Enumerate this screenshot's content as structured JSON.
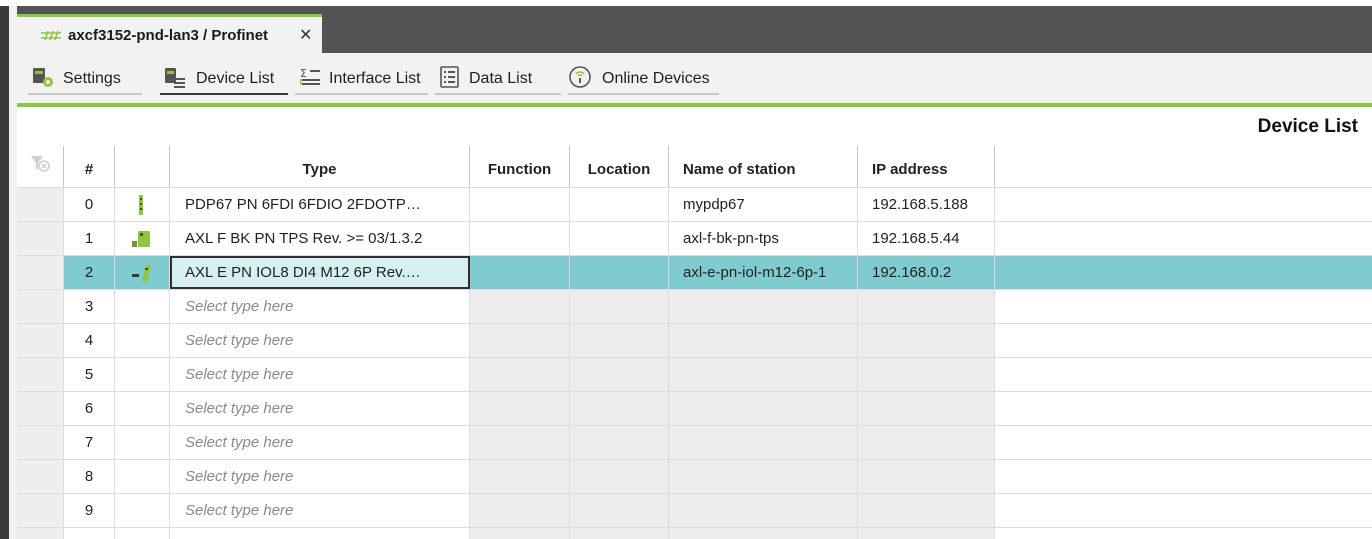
{
  "tab": {
    "title": "axcf3152-pnd-lan3 / Profinet",
    "close": "✕"
  },
  "toolbar": {
    "settings": "Settings",
    "device_list": "Device List",
    "interface_list": "Interface List",
    "data_list": "Data List",
    "online_devices": "Online Devices"
  },
  "page_title": "Device List",
  "columns": {
    "num": "#",
    "type": "Type",
    "function": "Function",
    "location": "Location",
    "station": "Name of station",
    "ip": "IP address"
  },
  "rows": [
    {
      "num": "0",
      "type": "PDP67 PN 6FDI 6FDIO 2FDOTP…",
      "function": "",
      "location": "",
      "station": "mypdp67",
      "ip": "192.168.5.188"
    },
    {
      "num": "1",
      "type": "AXL F BK PN TPS Rev. >= 03/1.3.2",
      "function": "",
      "location": "",
      "station": "axl-f-bk-pn-tps",
      "ip": "192.168.5.44"
    },
    {
      "num": "2",
      "type": "AXL E PN IOL8 DI4 M12 6P Rev.…",
      "function": "",
      "location": "",
      "station": "axl-e-pn-iol-m12-6p-1",
      "ip": "192.168.0.2"
    },
    {
      "num": "3",
      "type": "Select type here"
    },
    {
      "num": "4",
      "type": "Select type here"
    },
    {
      "num": "5",
      "type": "Select type here"
    },
    {
      "num": "6",
      "type": "Select type here"
    },
    {
      "num": "7",
      "type": "Select type here"
    },
    {
      "num": "8",
      "type": "Select type here"
    },
    {
      "num": "9",
      "type": "Select type here"
    }
  ],
  "colors": {
    "accent": "#8dc63f",
    "selection": "#7fcbd0"
  }
}
